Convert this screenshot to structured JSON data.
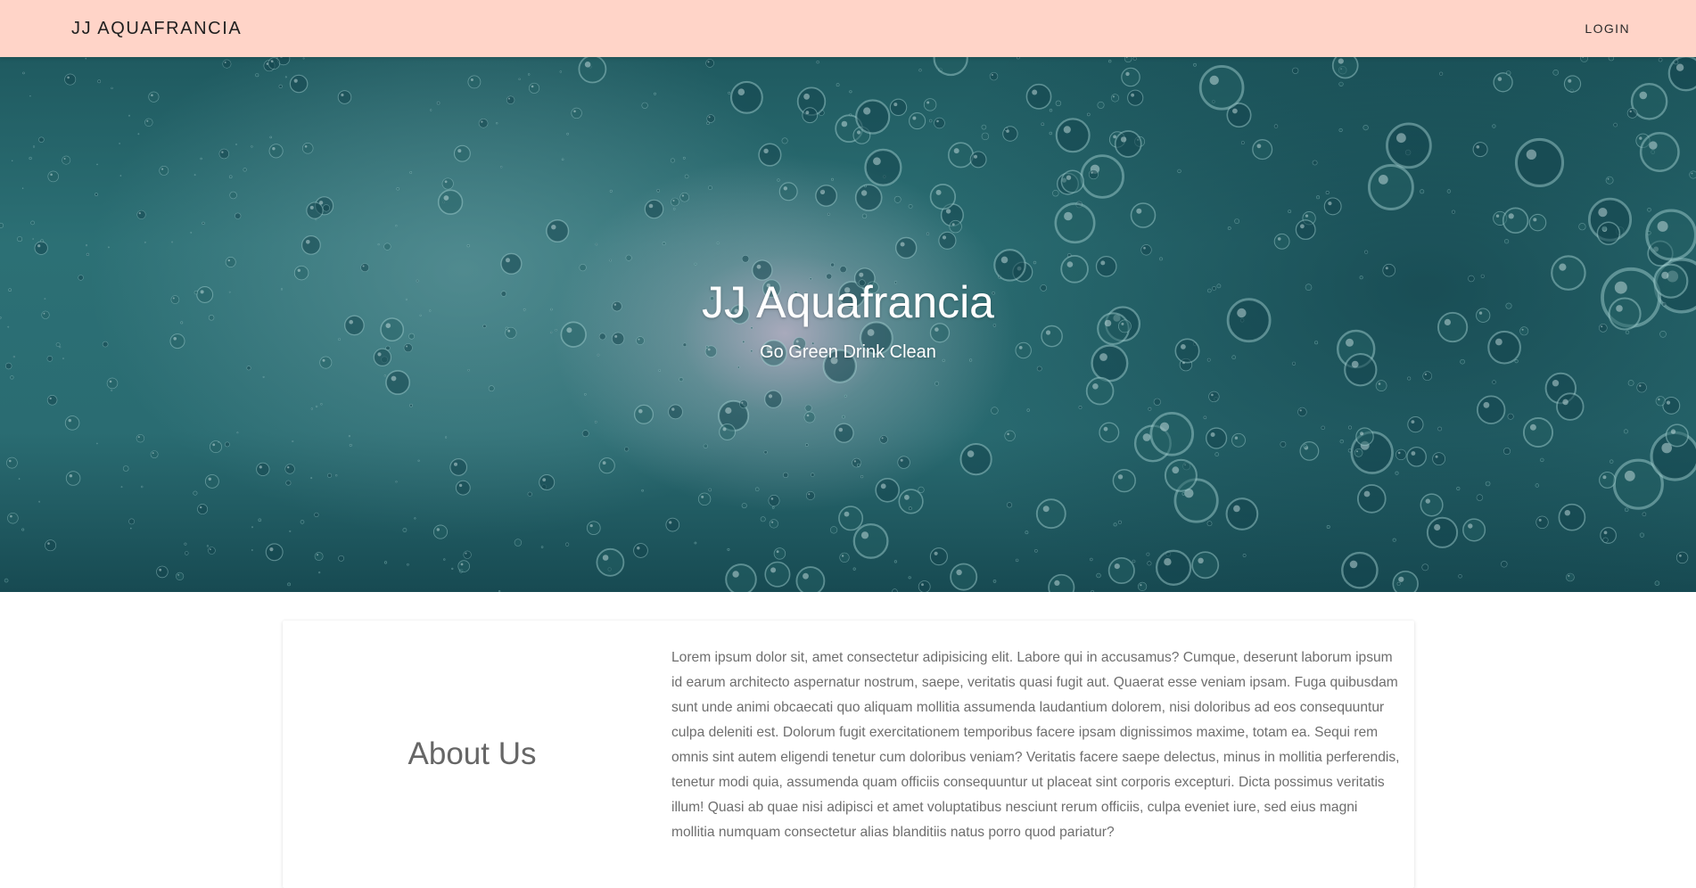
{
  "navbar": {
    "brand": "JJ AQUAFRANCIA",
    "login_label": "LOGIN",
    "background": "#ffd4c8"
  },
  "hero": {
    "title": "JJ Aquafrancia",
    "subtitle": "Go Green Drink Clean"
  },
  "about": {
    "heading": "About Us",
    "body": "Lorem ipsum dolor sit, amet consectetur adipisicing elit. Labore qui in accusamus? Cumque, deserunt laborum ipsum id earum architecto aspernatur nostrum, saepe, veritatis quasi fugit aut. Quaerat esse veniam ipsam. Fuga quibusdam sunt unde animi obcaecati quo aliquam mollitia assumenda laudantium dolorem, nisi doloribus ad eos consequuntur culpa deleniti est. Dolorum fugit exercitationem temporibus facere ipsam dignissimos maxime, totam ea. Sequi rem omnis sint autem eligendi tenetur cum doloribus veniam? Veritatis facere saepe delectus, minus in mollitia perferendis, tenetur modi quia, assumenda quam officiis consequuntur ut placeat sint corporis excepturi. Dicta possimus veritatis illum! Quasi ab quae nisi adipisci et amet voluptatibus nesciunt rerum officiis, culpa eveniet iure, sed eius magni mollitia numquam consectetur alias blanditiis natus porro quod pariatur?"
  }
}
